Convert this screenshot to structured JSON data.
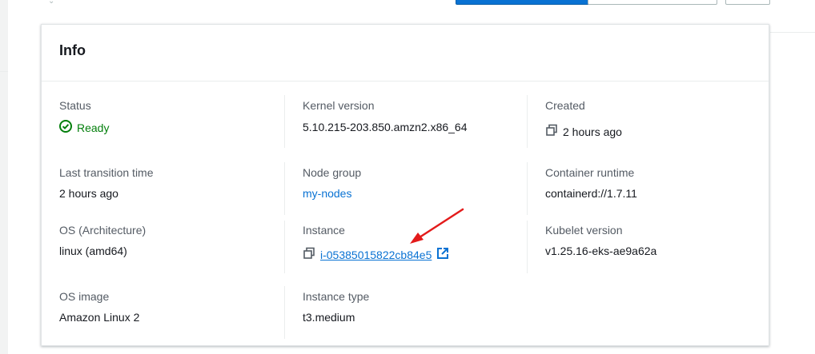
{
  "card": {
    "title": "Info"
  },
  "fields": {
    "status": {
      "label": "Status",
      "value": "Ready"
    },
    "kernel_version": {
      "label": "Kernel version",
      "value": "5.10.215-203.850.amzn2.x86_64"
    },
    "created": {
      "label": "Created",
      "value": "2 hours ago"
    },
    "last_transition_time": {
      "label": "Last transition time",
      "value": "2 hours ago"
    },
    "node_group": {
      "label": "Node group",
      "value": "my-nodes"
    },
    "container_runtime": {
      "label": "Container runtime",
      "value": "containerd://1.7.11"
    },
    "os_architecture": {
      "label": "OS (Architecture)",
      "value": "linux (amd64)"
    },
    "instance": {
      "label": "Instance",
      "value": "i-05385015822cb84e5"
    },
    "kubelet_version": {
      "label": "Kubelet version",
      "value": "v1.25.16-eks-ae9a62a"
    },
    "os_image": {
      "label": "OS image",
      "value": "Amazon Linux 2"
    },
    "instance_type": {
      "label": "Instance type",
      "value": "t3.medium"
    }
  },
  "icons": {
    "status": "status-positive-icon",
    "copy": "copy-icon",
    "external": "external-link-icon",
    "annotation": "red-arrow-annotation"
  },
  "colors": {
    "link": "#0972d3",
    "success": "#037f0c",
    "annotation_arrow": "#e31b1b",
    "primary_button": "#0972d3"
  }
}
